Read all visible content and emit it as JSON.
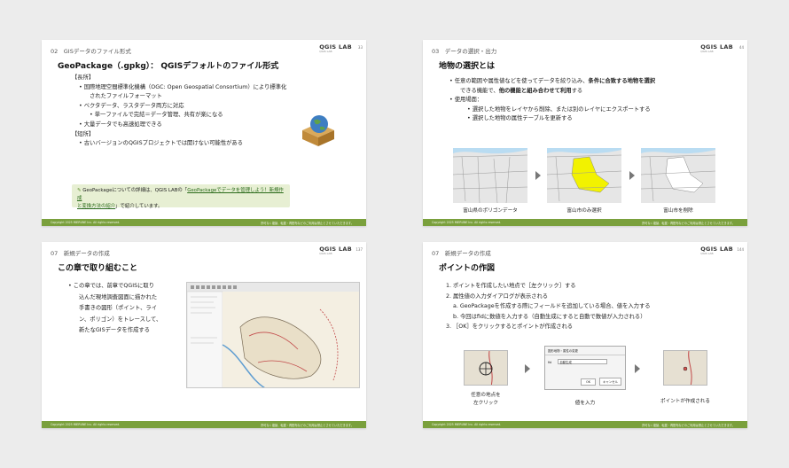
{
  "colors": {
    "accent": "#7aa03c",
    "note_bg": "#e7efd3",
    "selection": "#f2f200"
  },
  "brand": {
    "name": "QGIS LAB",
    "sub": "QGIS LAB"
  },
  "footer": {
    "copyright": "Copyright 2025 MIERUNE Inc. All rights reserved.",
    "notice": "許可なく複製、転載・再配布などのご利用は禁止とさせていただきます。"
  },
  "slides": [
    {
      "section": "02　GISデータのファイル形式",
      "page": "33",
      "title": "GeoPackage（.gpkg）：  QGISデフォルトのファイル形式",
      "pros_heading": "【長所】",
      "pros": [
        "国際地理空間標準化機構（OGC: Open Geospatial Consortium）により標準化",
        "されたファイルフォーマット",
        "ベクタデータ、ラスタデータ両方に対応",
        "単一ファイルで完結＝データ管理、共有が楽になる",
        "大量データでも高速処理できる"
      ],
      "cons_heading": "【短所】",
      "cons": [
        "古いバージョンのQGISプロジェクトでは開けない可能性がある"
      ],
      "note_prefix": "GeoPackageについての詳細は、QGIS LABの「",
      "note_link1": "GeoPackageでデータを管理しよう！新規作成",
      "note_link2": "と変換方法の紹介",
      "note_suffix": "」で紹介しています。",
      "icon": "globe-in-box-icon"
    },
    {
      "section": "03　データの選択・出力",
      "page": "44",
      "title": "地物の選択とは",
      "lines": [
        {
          "pre": "任意の範囲や属性値などを使ってデータを絞り込み、",
          "bold": "条件に合致する地物を選択"
        },
        {
          "pre": "できる機能で、",
          "bold": "他の機能と組み合わせて利用",
          "post": "する"
        },
        {
          "pre": "使用場面："
        },
        {
          "pre": "選択した地物をレイヤから削除、または別のレイヤにエクスポートする"
        },
        {
          "pre": "選択した地物の属性テーブルを更新する"
        }
      ],
      "captions": [
        "富山県のポリゴンデータ",
        "富山市のみ選択",
        "富山市を削除"
      ]
    },
    {
      "section": "07　新規データの作成",
      "page": "137",
      "title": "この章で取り組むこと",
      "lines": [
        "この章では、前章でQGISに取り",
        "込んだ現地調査図面に描かれた",
        "手書きの図形（ポイント、ライ",
        "ン、ポリゴン）をトレースして、",
        "新たなGISデータを作成する"
      ]
    },
    {
      "section": "07　新規データの作成",
      "page": "144",
      "title": "ポイントの作図",
      "steps": [
        "1. ポイントを作成したい地点で［左クリック］する",
        "2. 属性値の入力ダイアログが表示される",
        "a. GeoPackageを作成する際にフィールドを追加している場合、値を入力する",
        "b. 今回はfidに数値を入力する（自動生成にすると自動で数値が入力される）",
        "3. ［OK］をクリックするとポイントが作成される"
      ],
      "captions": [
        "任意の地点を",
        "左クリック",
        "値を入力",
        "ポイントが作成される"
      ],
      "dialog": {
        "title": "図形地物・属性の変更",
        "field_label": "fid",
        "field_value": "自動生成",
        "ok": "OK",
        "cancel": "キャンセル"
      }
    }
  ]
}
